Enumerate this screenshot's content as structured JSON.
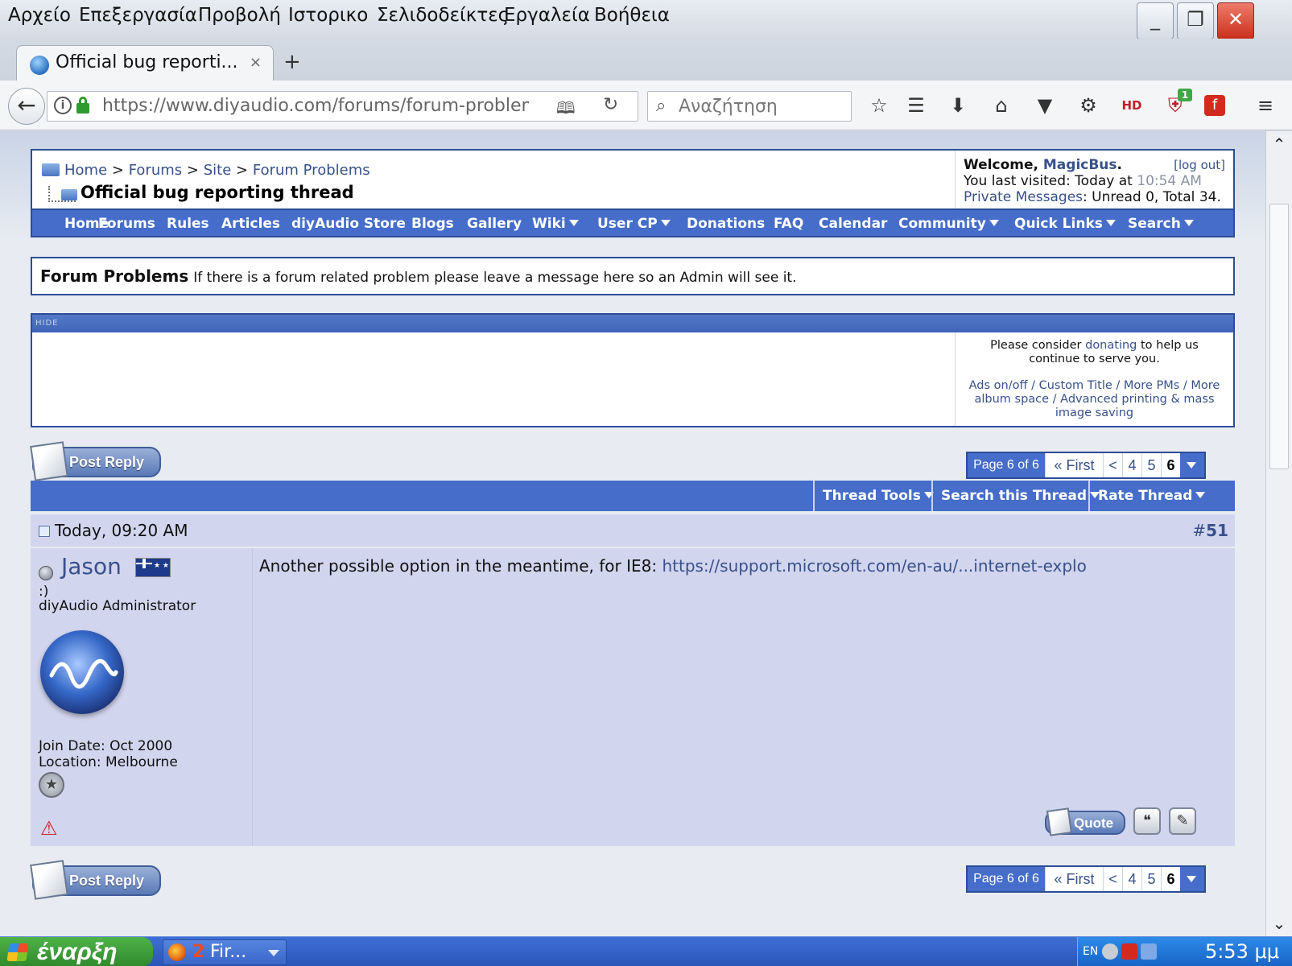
{
  "menubar": {
    "items": [
      "Αρχείο",
      "Επεξεργασία",
      "Προβολή",
      "Ιστορικο",
      "Σελιδοδείκτες",
      "Εργαλεία",
      "Βοήθεια"
    ]
  },
  "window_controls": {
    "minimize": "_",
    "restore": "❐",
    "close": "✕"
  },
  "tab": {
    "title": "Official bug reporti...",
    "close": "×",
    "new_tab": "+"
  },
  "address_bar": {
    "url": "https://www.diyaudio.com/forums/forum-problems",
    "search_placeholder": "Αναζήτηση"
  },
  "toolbar": {
    "addon_badge": "1"
  },
  "breadcrumb": {
    "home": "Home",
    "forums": "Forums",
    "site": "Site",
    "forum_problems": "Forum Problems",
    "sep": ">"
  },
  "thread_title": "Official bug reporting thread",
  "welcome": {
    "greeting": "Welcome, ",
    "username": "MagicBus",
    "logout": "[log out]",
    "last_visited_label": "You last visited: Today at ",
    "last_visited_time": "10:54 AM",
    "pm_label": "Private Messages",
    "pm_stats": ": Unread 0, Total 34."
  },
  "nav": [
    {
      "label": "Home",
      "dropdown": false
    },
    {
      "label": "Forums",
      "dropdown": false
    },
    {
      "label": "Rules",
      "dropdown": false
    },
    {
      "label": "Articles",
      "dropdown": false
    },
    {
      "label": "diyAudio Store",
      "dropdown": false
    },
    {
      "label": "Blogs",
      "dropdown": false
    },
    {
      "label": "Gallery",
      "dropdown": false
    },
    {
      "label": "Wiki",
      "dropdown": true
    },
    {
      "label": "User CP",
      "dropdown": true
    },
    {
      "label": "Donations",
      "dropdown": false
    },
    {
      "label": "FAQ",
      "dropdown": false
    },
    {
      "label": "Calendar",
      "dropdown": false
    },
    {
      "label": "Community",
      "dropdown": true
    },
    {
      "label": "Quick Links",
      "dropdown": true
    },
    {
      "label": "Search",
      "dropdown": true
    }
  ],
  "forum_desc": {
    "title": "Forum Problems",
    "text": "If there is a forum related problem please leave a message here so an Admin will see it."
  },
  "donate": {
    "hide": "HIDE",
    "line1_pre": "Please consider ",
    "line1_link": "donating",
    "line1_post": " to help us continue to serve you.",
    "perks": "Ads on/off / Custom Title / More PMs / More album space / Advanced printing & mass image saving"
  },
  "post_reply_label": "Post Reply",
  "pagination": {
    "label": "Page 6 of 6",
    "first": "« First",
    "prev": "<",
    "pages": [
      "4",
      "5",
      "6"
    ],
    "current": "6"
  },
  "thread_tools": [
    "Thread Tools",
    "Search this Thread",
    "Rate Thread"
  ],
  "post": {
    "date": "Today, 09:20 AM",
    "number_prefix": "#",
    "number": "51",
    "user": {
      "name": "Jason",
      "smile": ":)",
      "title": "diyAudio Administrator",
      "join_date": "Join Date: Oct 2000",
      "location": "Location: Melbourne"
    },
    "message_text": "Another possible option in the meantime, for IE8: ",
    "message_link": "https://support.microsoft.com/en-au/...internet-explo",
    "quote_label": "Quote"
  },
  "taskbar": {
    "start": "έναρξη",
    "firefox_count": "2",
    "firefox_label": "Fir...",
    "lang": "EN",
    "clock": "5:53 μμ"
  },
  "colors": {
    "accent": "#456dc9",
    "border": "#2c4d96",
    "link": "#38518b",
    "post_bg": "#d2d5ee"
  }
}
